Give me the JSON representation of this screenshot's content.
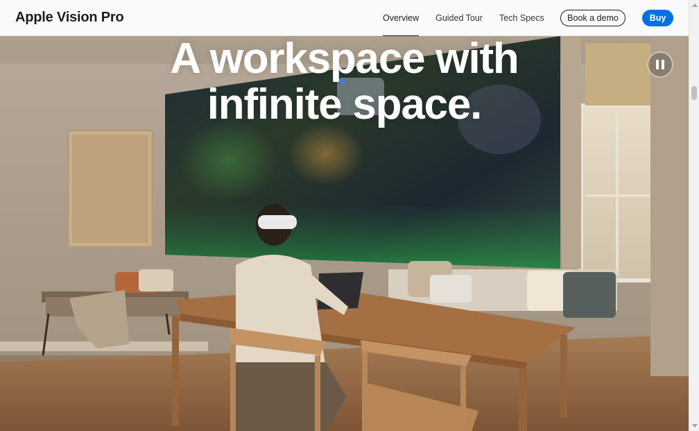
{
  "nav": {
    "brand": "Apple Vision Pro",
    "links": [
      {
        "label": "Overview",
        "active": true
      },
      {
        "label": "Guided Tour",
        "active": false
      },
      {
        "label": "Tech Specs",
        "active": false
      }
    ],
    "demo_label": "Book a demo",
    "buy_label": "Buy"
  },
  "hero": {
    "headline_line1": "A workspace with",
    "headline_line2": "infinite space.",
    "pause_icon": "pause-icon",
    "scene": "person wearing headset at wooden table with floating virtual display"
  },
  "colors": {
    "accent": "#0071e3",
    "text": "#1d1d1f",
    "nav_bg": "#fafafc",
    "headline": "#ffffff"
  }
}
